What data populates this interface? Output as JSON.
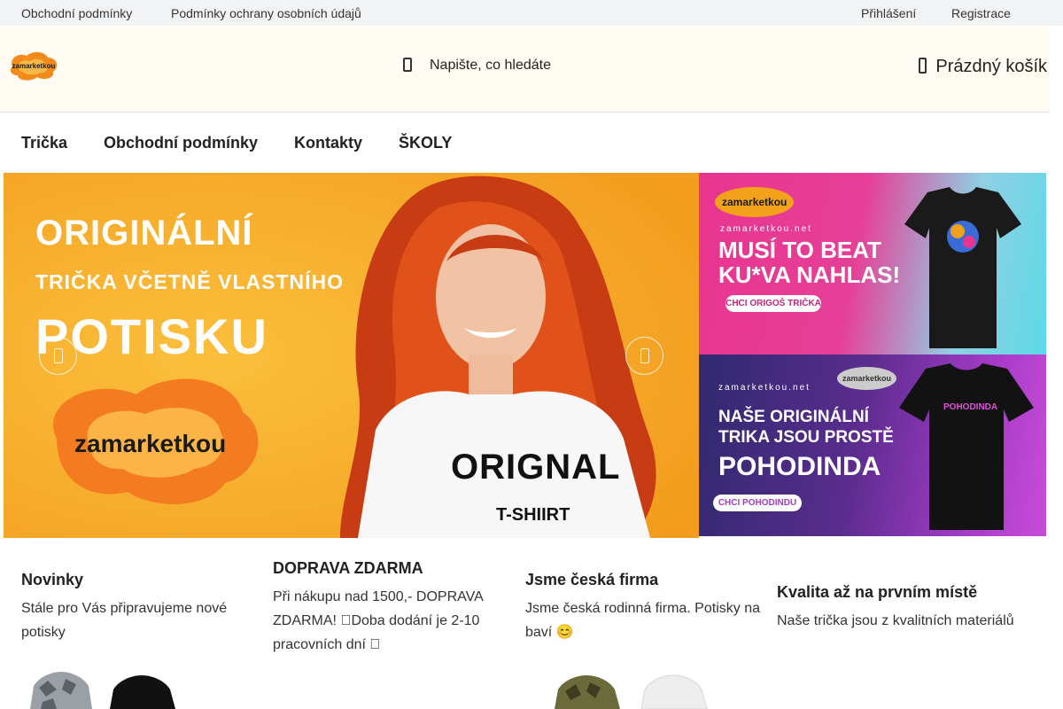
{
  "topbar": {
    "left_links": [
      "Obchodní podmínky",
      "Podmínky ochrany osobních údajů"
    ],
    "right_links": [
      "Přihlášení",
      "Registrace"
    ]
  },
  "header": {
    "logo_text": "zamarketkou",
    "search_placeholder": "Napište, co hledáte",
    "cart_label": "Prázdný košík"
  },
  "nav": {
    "items": [
      "Trička",
      "Obchodní podmínky",
      "Kontakty",
      "ŠKOLY"
    ]
  },
  "hero": {
    "line1": "ORIGINÁLNÍ",
    "line2": "TRIČKA VČETNĚ VLASTNÍHO",
    "line3": "POTISKU",
    "brand": "zamarketkou",
    "shirt_line1": "ORIGNAL",
    "shirt_line2": "T-SHIIRT"
  },
  "banner_top": {
    "logo": "zamarketkou",
    "site": "zamarketkou.net",
    "title_line1": "MUSÍ TO BEAT",
    "title_line2": "KU*VA NAHLAS!",
    "cta": "CHCI ORIGOŠ TRIČKA"
  },
  "banner_bottom": {
    "site": "zamarketkou.net",
    "logo": "zamarketkou",
    "title_line1": "NAŠE ORIGINÁLNÍ",
    "title_line2": "TRIKA JSOU PROSTĚ",
    "title_line3": "POHODINDA",
    "cta": "CHCI POHODINDU",
    "shirt_text": "POHODINDA"
  },
  "features": [
    {
      "title": "Novinky",
      "text": "Stále pro Vás připravujeme nové potisky"
    },
    {
      "title": "DOPRAVA ZDARMA",
      "text": "Při nákupu nad 1500,- DOPRAVA ZDARMA! Doba dodání je 2-10 pracovních dní "
    },
    {
      "title": "Jsme česká firma",
      "text": "Jsme česká rodinná firma. Potisky na baví 😊"
    },
    {
      "title": "Kvalita až na prvním místě",
      "text": "Naše trička jsou z kvalitních materiálů"
    }
  ],
  "colors": {
    "topbar_bg": "#f2f3f5",
    "header_bg": "#fffcf3",
    "hero_orange": "#f5a623",
    "banner_top_gradient": [
      "#e8358f",
      "#5dd9e6"
    ],
    "banner_bottom_gradient": [
      "#3a2b78",
      "#c43fd3"
    ]
  }
}
